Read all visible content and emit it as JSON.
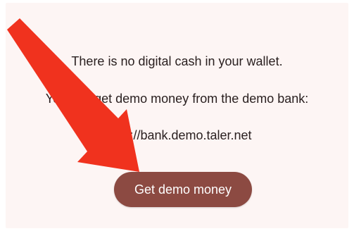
{
  "empty_state": {
    "no_cash_text": "There is no digital cash in your wallet.",
    "demo_hint_text": "You can get demo money from the demo bank:",
    "bank_url": "https://bank.demo.taler.net",
    "button_label": "Get demo money"
  },
  "colors": {
    "card_background": "#fdf5f4",
    "button_background": "#8c4a42",
    "annotation_arrow": "#f0321e"
  },
  "icons": {
    "annotation": "red-arrow-icon"
  }
}
